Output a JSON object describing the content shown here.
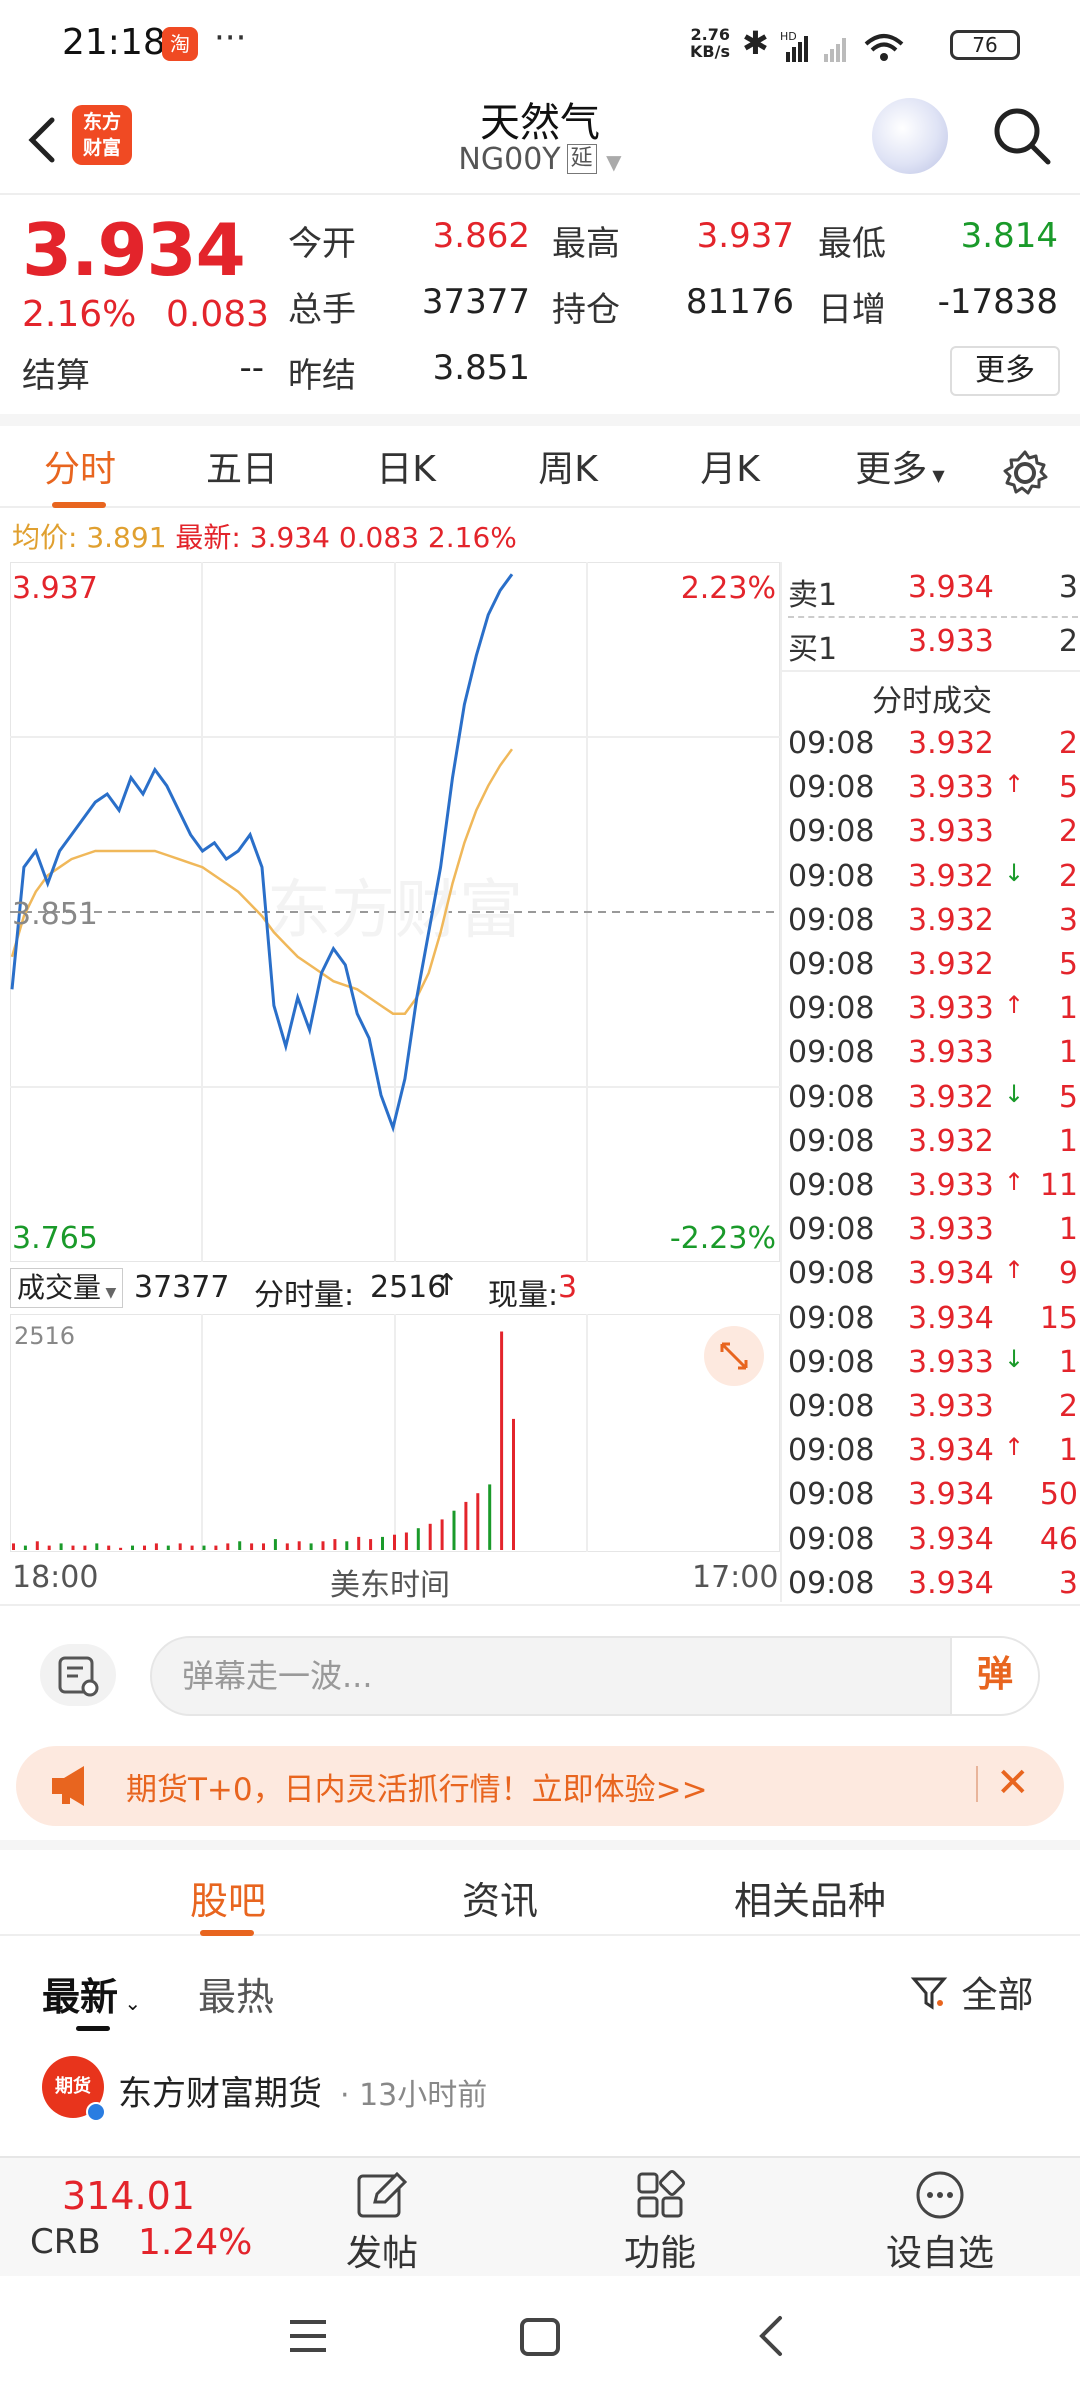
{
  "status_bar": {
    "time": "21:18",
    "notification_badge": "淘",
    "more": "···",
    "net_speed_value": "2.76",
    "net_speed_unit": "KB/s",
    "battery": "76"
  },
  "header": {
    "logo_line1": "东方",
    "logo_line2": "财富",
    "title": "天然气",
    "code": "NG00Y",
    "delay_tag": "延"
  },
  "quote": {
    "price": "3.934",
    "change_pct": "2.16%",
    "change": "0.083",
    "settle_label": "结算",
    "settle_value": "--",
    "open_label": "今开",
    "open_value": "3.862",
    "high_label": "最高",
    "high_value": "3.937",
    "low_label": "最低",
    "low_value": "3.814",
    "volume_label": "总手",
    "volume_value": "37377",
    "oi_label": "持仓",
    "oi_value": "81176",
    "daily_inc_label": "日增",
    "daily_inc_value": "-17838",
    "prev_settle_label": "昨结",
    "prev_settle_value": "3.851",
    "more_button": "更多"
  },
  "tabs": [
    "分时",
    "五日",
    "日K",
    "周K",
    "月K",
    "更多"
  ],
  "avg_line": {
    "avg_label": "均价:",
    "avg_value": "3.891",
    "latest_label": "最新:",
    "latest_value": "3.934",
    "latest_change": "0.083",
    "latest_pct": "2.16%"
  },
  "chart_data": {
    "type": "line",
    "ylim": [
      3.765,
      3.937
    ],
    "y_top_label": "3.937",
    "y_mid_label": "3.851",
    "y_bottom_label": "3.765",
    "pct_top_label": "2.23%",
    "pct_bottom_label": "-2.23%",
    "watermark": "东方财富",
    "x_start_label": "18:00",
    "x_mid_label": "美东时间",
    "x_end_label": "17:00",
    "series": [
      {
        "values": [
          3.832,
          3.862,
          3.866,
          3.858,
          3.866,
          3.87,
          3.874,
          3.878,
          3.88,
          3.876,
          3.884,
          3.88,
          3.886,
          3.882,
          3.876,
          3.87,
          3.866,
          3.868,
          3.864,
          3.866,
          3.87,
          3.862,
          3.828,
          3.818,
          3.83,
          3.822,
          3.836,
          3.842,
          3.838,
          3.826,
          3.82,
          3.806,
          3.798,
          3.81,
          3.83,
          3.846,
          3.862,
          3.884,
          3.902,
          3.914,
          3.924,
          3.93,
          3.934
        ]
      },
      {
        "values": [
          3.84,
          3.85,
          3.856,
          3.86,
          3.862,
          3.864,
          3.865,
          3.866,
          3.866,
          3.866,
          3.866,
          3.866,
          3.866,
          3.865,
          3.864,
          3.863,
          3.862,
          3.86,
          3.858,
          3.856,
          3.853,
          3.85,
          3.846,
          3.843,
          3.84,
          3.838,
          3.836,
          3.834,
          3.833,
          3.832,
          3.83,
          3.828,
          3.826,
          3.826,
          3.83,
          3.836,
          3.846,
          3.858,
          3.868,
          3.876,
          3.882,
          3.887,
          3.891
        ]
      }
    ],
    "volume": {
      "selector_label": "成交量",
      "total": "37377",
      "tick_label": "分时量:",
      "tick_value": "2516",
      "current_label": "现量:",
      "current_value": "3",
      "max_label": "2516",
      "bars": [
        3,
        2,
        4,
        2,
        3,
        2,
        2,
        3,
        2,
        1,
        2,
        2,
        3,
        2,
        3,
        2,
        2,
        2,
        3,
        4,
        3,
        3,
        5,
        3,
        4,
        3,
        4,
        5,
        4,
        6,
        5,
        6,
        7,
        8,
        10,
        12,
        14,
        18,
        22,
        26,
        30,
        100,
        60
      ]
    }
  },
  "order_book": {
    "ask_label": "卖1",
    "ask_price": "3.934",
    "ask_qty": "3",
    "bid_label": "买1",
    "bid_price": "3.933",
    "bid_qty": "2",
    "trades_title": "分时成交",
    "trades": [
      {
        "time": "09:08",
        "price": "3.932",
        "dir": "",
        "qty": "2"
      },
      {
        "time": "09:08",
        "price": "3.933",
        "dir": "↑",
        "qty": "5"
      },
      {
        "time": "09:08",
        "price": "3.933",
        "dir": "",
        "qty": "2"
      },
      {
        "time": "09:08",
        "price": "3.932",
        "dir": "↓",
        "qty": "2"
      },
      {
        "time": "09:08",
        "price": "3.932",
        "dir": "",
        "qty": "3"
      },
      {
        "time": "09:08",
        "price": "3.932",
        "dir": "",
        "qty": "5"
      },
      {
        "time": "09:08",
        "price": "3.933",
        "dir": "↑",
        "qty": "1"
      },
      {
        "time": "09:08",
        "price": "3.933",
        "dir": "",
        "qty": "1"
      },
      {
        "time": "09:08",
        "price": "3.932",
        "dir": "↓",
        "qty": "5"
      },
      {
        "time": "09:08",
        "price": "3.932",
        "dir": "",
        "qty": "1"
      },
      {
        "time": "09:08",
        "price": "3.933",
        "dir": "↑",
        "qty": "11"
      },
      {
        "time": "09:08",
        "price": "3.933",
        "dir": "",
        "qty": "1"
      },
      {
        "time": "09:08",
        "price": "3.934",
        "dir": "↑",
        "qty": "9"
      },
      {
        "time": "09:08",
        "price": "3.934",
        "dir": "",
        "qty": "15"
      },
      {
        "time": "09:08",
        "price": "3.933",
        "dir": "↓",
        "qty": "1"
      },
      {
        "time": "09:08",
        "price": "3.933",
        "dir": "",
        "qty": "2"
      },
      {
        "time": "09:08",
        "price": "3.934",
        "dir": "↑",
        "qty": "1"
      },
      {
        "time": "09:08",
        "price": "3.934",
        "dir": "",
        "qty": "50"
      },
      {
        "time": "09:08",
        "price": "3.934",
        "dir": "",
        "qty": "46"
      },
      {
        "time": "09:08",
        "price": "3.934",
        "dir": "",
        "qty": "3"
      }
    ]
  },
  "danmu": {
    "placeholder": "弹幕走一波...",
    "send": "弹"
  },
  "promo": {
    "text": "期货T+0，日内灵活抓行情！立即体验>>"
  },
  "section_tabs": [
    "股吧",
    "资讯",
    "相关品种"
  ],
  "filter": {
    "latest": "最新",
    "hottest": "最热",
    "all": "全部"
  },
  "post": {
    "avatar_text": "期货",
    "author": "东方财富期货",
    "time": "· 13小时前"
  },
  "bottom_bar": {
    "crb_value": "314.01",
    "crb_label": "CRB",
    "crb_pct": "1.24%",
    "post_label": "发帖",
    "func_label": "功能",
    "watch_label": "设自选"
  },
  "colors": {
    "up": "#e3242b",
    "down": "#1a9a2a",
    "accent": "#e8651f",
    "price_line": "#2a6fc9",
    "avg_line": "#f0b85a"
  }
}
